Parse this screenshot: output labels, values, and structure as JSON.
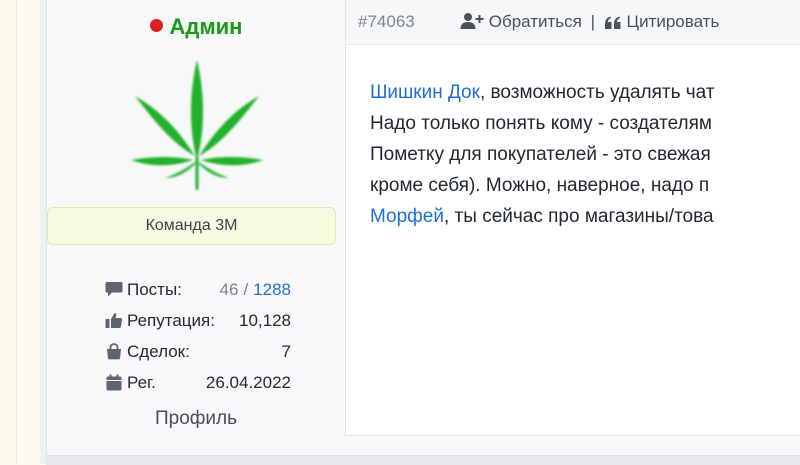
{
  "user": {
    "name": "Админ",
    "online_color": "#e02020",
    "name_color": "#1a9a18",
    "avatar_icon": "cannabis-leaf-icon",
    "team_badge": "Команда 3М",
    "stats": {
      "posts_label": "Посты:",
      "posts_value": "46",
      "posts_sep": "/",
      "posts_total": "1288",
      "reputation_label": "Репутация:",
      "reputation_value": "10,128",
      "deals_label": "Сделок:",
      "deals_value": "7",
      "registered_label": "Рег.",
      "registered_value": "26.04.2022"
    },
    "profile_link": "Профиль"
  },
  "post": {
    "number": "#74063",
    "actions": {
      "contact": "Обратиться",
      "separator": "|",
      "quote": "Цитировать"
    },
    "message": {
      "line1_mention": "Шишкин Док",
      "line1_text": ", возможность удалять чат",
      "line2_text": "Надо только понять кому - создателям",
      "line3_text": "Пометку для покупателей - это свежая",
      "line4_text": "кроме себя). Можно, наверное, надо п",
      "line5_mention": "Морфей",
      "line5_text": ", ты сейчас про магазины/това"
    }
  }
}
